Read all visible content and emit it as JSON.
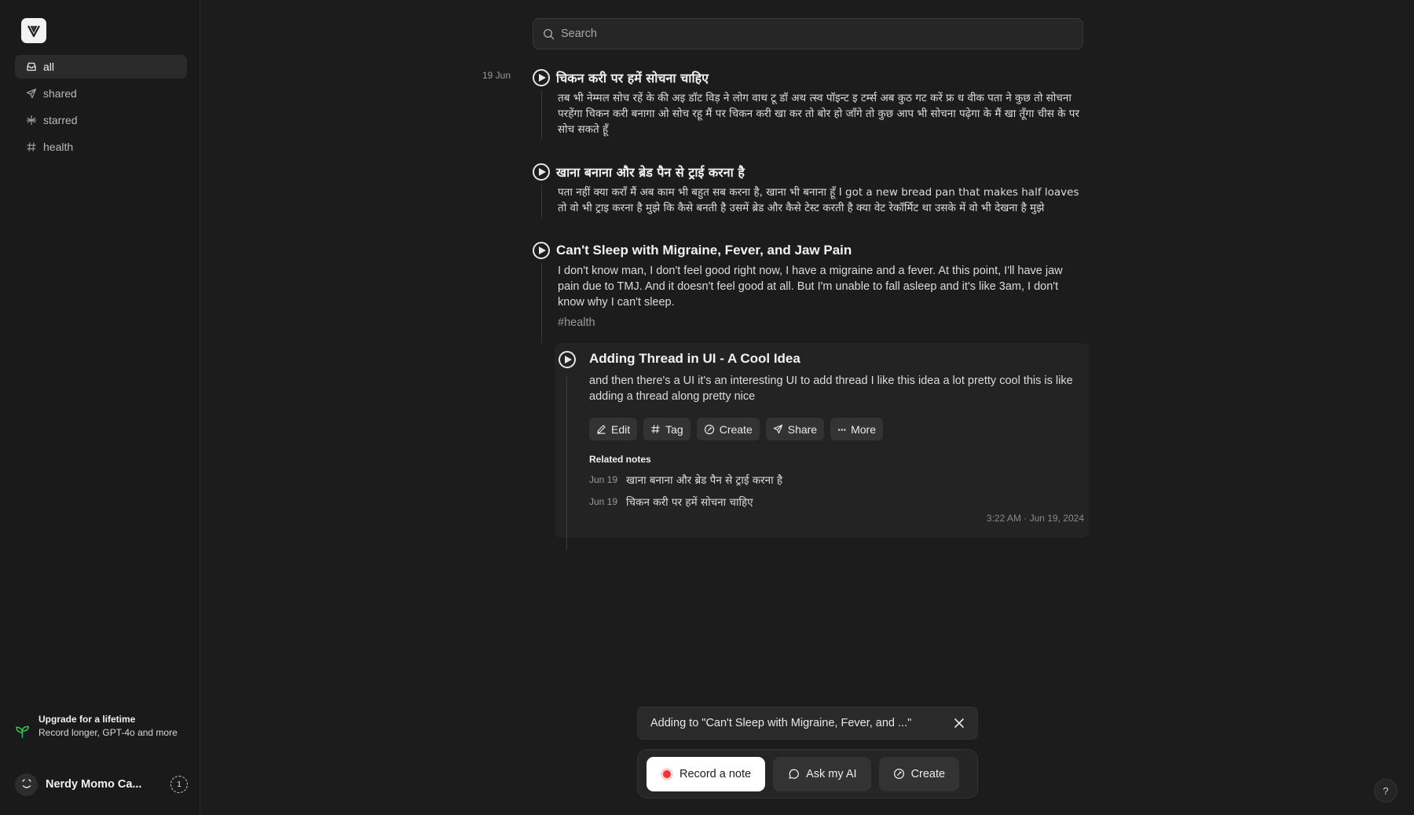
{
  "sidebar": {
    "nav": [
      {
        "label": "all",
        "icon": "inbox-icon",
        "active": true
      },
      {
        "label": "shared",
        "icon": "send-icon",
        "active": false
      },
      {
        "label": "starred",
        "icon": "asterisk-icon",
        "active": false
      },
      {
        "label": "health",
        "icon": "hash-icon",
        "active": false
      }
    ],
    "upgrade": {
      "title": "Upgrade for a lifetime",
      "desc": "Record longer, GPT-4o and more"
    },
    "user": {
      "name": "Nerdy Momo Ca...",
      "badge": "1"
    }
  },
  "search": {
    "placeholder": "Search"
  },
  "date_group": "19 Jun",
  "notes": [
    {
      "title": "चिकन करी पर हमें सोचना चाहिए",
      "body": "तब भी नेम्मल सोच रहें के की अइ डॉट विड़ ने लोग वाथ टू डॉ अथ त्स्व पॉइन्ट इ टर्म्स अब कुठ गट करें फ्र ध वीक पता ने कुछ तो सोचना परहेंगा चिकन करी बनागा ओ सोच रहू मैं पर चिकन करी खा कर तो बोर हो जाँगे तो कुछ आप भी सोचना पढ़ेगा के मैं खा तूँगा चीस के पर सोच सकते हूँ"
    },
    {
      "title": "खाना बनाना और ब्रेड पैन से ट्राई करना है",
      "body": "पता नहीं क्या कराँ मैं अब काम भी बहुत सब करना है, खाना भी बनाना हूँ I got a new bread pan that makes half loaves तो वो भी ट्राइ करना है मुझे कि कैसे बनती है उसमें ब्रेड और कैसे टेस्ट करती है क्या वेट रेकॉर्मिट था उसके में वो भी देखना है मुझे"
    },
    {
      "title": "Can't Sleep with Migraine, Fever, and Jaw Pain",
      "body": "I don't know man, I don't feel good right now, I have a migraine and a fever. At this point, I'll have jaw pain due to TMJ. And it doesn't feel good at all. But I'm unable to fall asleep and it's like 3am, I don't know why I can't sleep.",
      "tag": "health"
    }
  ],
  "thread": {
    "title": "Adding Thread in UI - A Cool Idea",
    "body": "and then there's a UI it's an interesting UI to add thread I like this idea a lot pretty cool this is like adding a thread along pretty nice",
    "actions": [
      {
        "label": "Edit",
        "icon": "pencil-icon"
      },
      {
        "label": "Tag",
        "icon": "hash-icon"
      },
      {
        "label": "Create",
        "icon": "sparkle-circle-icon"
      },
      {
        "label": "Share",
        "icon": "send-icon"
      },
      {
        "label": "More",
        "icon": "ellipsis-icon"
      }
    ],
    "related_heading": "Related notes",
    "related": [
      {
        "date": "Jun 19",
        "title": "खाना बनाना और ब्रेड पैन से ट्राई करना है"
      },
      {
        "date": "Jun 19",
        "title": "चिकन करी पर हमें सोचना चाहिए"
      }
    ],
    "timestamp": "3:22 AM · Jun 19, 2024"
  },
  "composer": {
    "adding": "Adding to \"Can't Sleep with Migraine, Fever, and ...\"",
    "record": "Record a note",
    "ask": "Ask my AI",
    "create": "Create"
  },
  "help": "?",
  "colors": {
    "background": "#1c1c1c",
    "record_dot": "#e53935",
    "primary_button": "#ffffff"
  }
}
